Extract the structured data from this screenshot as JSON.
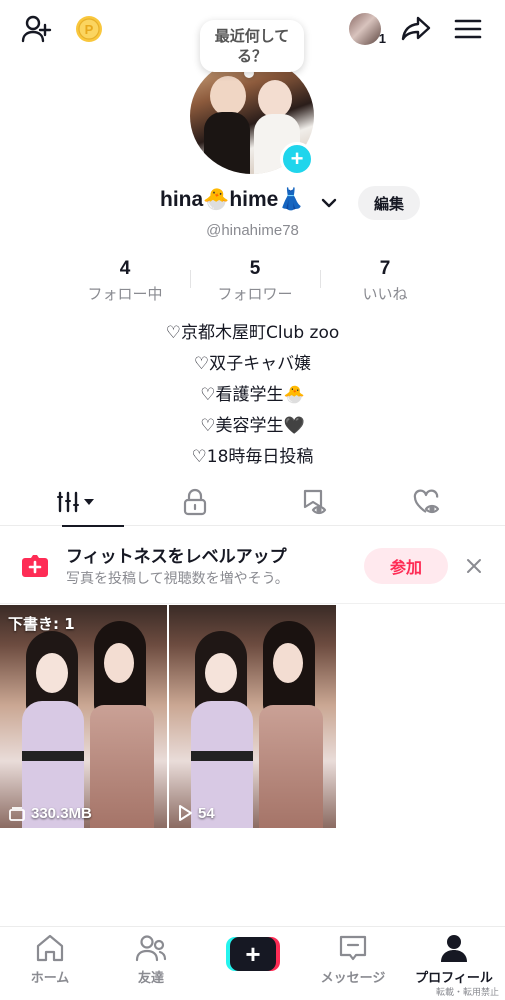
{
  "top_bar": {
    "avatar_count": "1"
  },
  "bubble": {
    "text": "最近何してる？"
  },
  "profile": {
    "display_name": "hina🐣hime👗",
    "username": "@hinahime78",
    "edit_label": "編集"
  },
  "stats": [
    {
      "value": "4",
      "label": "フォロー中"
    },
    {
      "value": "5",
      "label": "フォロワー"
    },
    {
      "value": "7",
      "label": "いいね"
    }
  ],
  "bio": [
    "♡京都木屋町Club zoo",
    "♡双子キャバ嬢",
    "♡看護学生🐣",
    "♡美容学生🖤",
    "♡18時毎日投稿"
  ],
  "promo": {
    "title": "フィットネスをレベルアップ",
    "subtitle": "写真を投稿して視聴数を増やそう。",
    "join_label": "参加"
  },
  "videos": [
    {
      "draft_label": "下書き: 1",
      "meta": "330.3MB"
    },
    {
      "meta": "54"
    }
  ],
  "nav": {
    "home": "ホーム",
    "friends": "友達",
    "messages": "メッセージ",
    "profile": "プロフィール"
  },
  "watermark": "転載・転用禁止",
  "colors": {
    "accent": "#fe2c55",
    "cyan": "#20d5ec",
    "text": "#161823",
    "muted": "#8a8b91"
  }
}
